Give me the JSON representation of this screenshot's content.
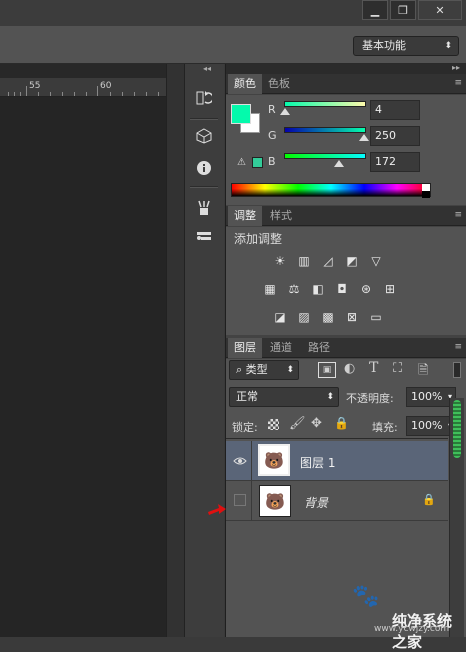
{
  "window": {
    "minimize": "▁",
    "restore": "❐",
    "close": "✕"
  },
  "options_bar": {
    "workspace": "基本功能"
  },
  "ruler": {
    "marks": [
      "55",
      "60"
    ]
  },
  "tools": [
    "history-icon",
    "3d-cube-icon",
    "info-icon",
    "brush-presets-icon",
    "tool-presets-icon"
  ],
  "color_panel": {
    "tabs": [
      "颜色",
      "色板"
    ],
    "foreground_color": "#04faac",
    "channels": [
      {
        "label": "R",
        "value": "4",
        "gradient": [
          "#04faac",
          "#fffaac"
        ],
        "fraction": 0.016
      },
      {
        "label": "G",
        "value": "250",
        "gradient": [
          "#0400ac",
          "#04ffac"
        ],
        "fraction": 0.98
      },
      {
        "label": "B",
        "value": "172",
        "gradient": [
          "#04fa00",
          "#04faff"
        ],
        "fraction": 0.67
      }
    ]
  },
  "adjustments_panel": {
    "tabs": [
      "调整",
      "样式"
    ],
    "title": "添加调整",
    "rows": [
      [
        "brightness-icon",
        "levels-icon",
        "curves-icon",
        "exposure-icon",
        "vibrance-icon"
      ],
      [
        "hue-saturation-icon",
        "color-balance-icon",
        "black-white-icon",
        "photo-filter-icon",
        "channel-mixer-icon",
        "color-lookup-icon"
      ],
      [
        "invert-icon",
        "posterize-icon",
        "threshold-icon",
        "selective-color-icon",
        "gradient-map-icon"
      ]
    ]
  },
  "layers_panel": {
    "tabs": [
      "图层",
      "通道",
      "路径"
    ],
    "filter_label": "类型",
    "blend_mode": "正常",
    "opacity_label": "不透明度:",
    "opacity_value": "100%",
    "lock_label": "锁定:",
    "fill_label": "填充:",
    "fill_value": "100%",
    "layers": [
      {
        "name": "图层 1",
        "visible": true,
        "selected": true
      },
      {
        "name": "背景",
        "visible": false,
        "selected": false,
        "locked": true
      }
    ]
  },
  "watermark": {
    "text": "纯净系统之家",
    "url": "www.ycwjzy.com"
  }
}
